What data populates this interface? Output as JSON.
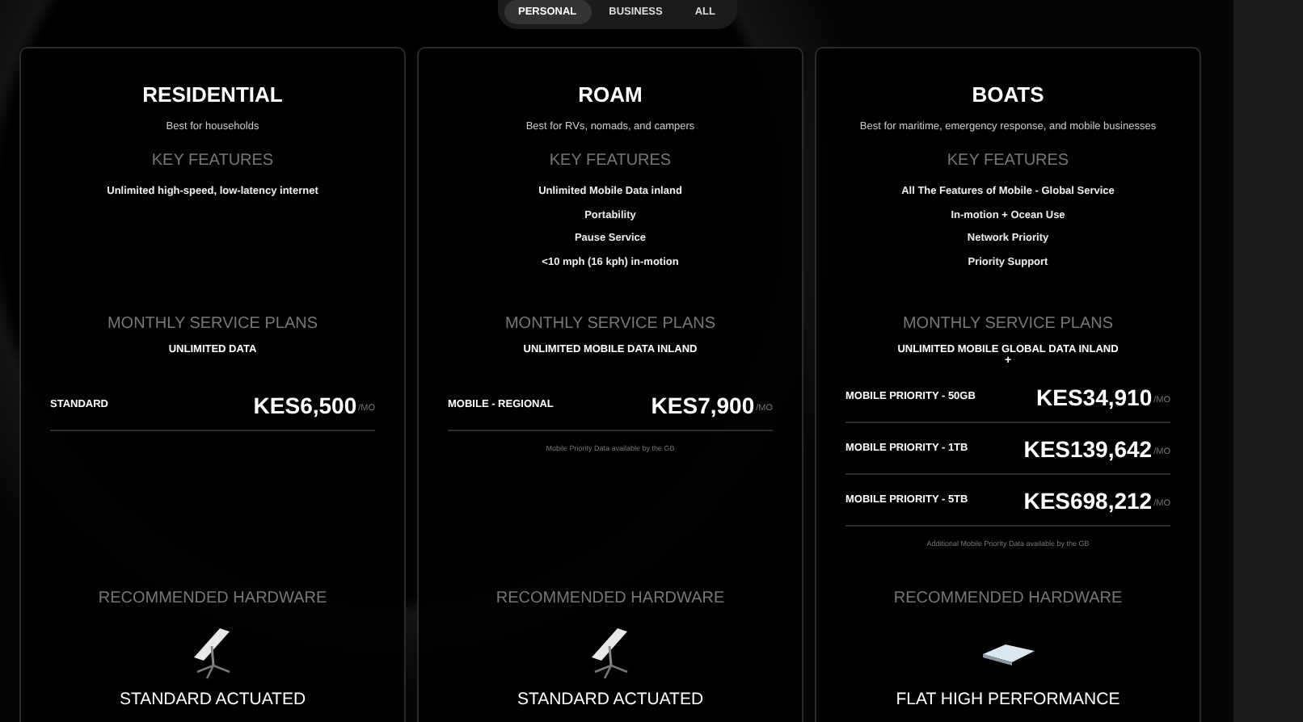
{
  "tabs": [
    {
      "label": "PERSONAL",
      "selected": true
    },
    {
      "label": "BUSINESS",
      "selected": false
    },
    {
      "label": "ALL",
      "selected": false
    }
  ],
  "cards": [
    {
      "title": "RESIDENTIAL",
      "subtitle": "Best for households",
      "features_heading": "KEY FEATURES",
      "features": [
        "Unlimited high-speed, low-latency internet"
      ],
      "plans_heading": "MONTHLY SERVICE PLANS",
      "plans_subheading": "UNLIMITED DATA",
      "plans": [
        {
          "name": "STANDARD",
          "price": "KES6,500",
          "unit": "/MO"
        }
      ],
      "hardware_heading": "RECOMMENDED HARDWARE",
      "hardware": {
        "kind": "standard",
        "name": "STANDARD ACTUATED"
      }
    },
    {
      "title": "ROAM",
      "subtitle": "Best for RVs, nomads, and campers",
      "features_heading": "KEY FEATURES",
      "features": [
        "Unlimited Mobile Data inland",
        "Portability",
        "Pause Service",
        "<10 mph (16 kph) in-motion"
      ],
      "plans_heading": "MONTHLY SERVICE PLANS",
      "plans_subheading": "UNLIMITED MOBILE DATA INLAND",
      "plans": [
        {
          "name": "MOBILE - REGIONAL",
          "price": "KES7,900",
          "unit": "/MO"
        }
      ],
      "plans_note": "Mobile Priority Data available by the GB",
      "hardware_heading": "RECOMMENDED HARDWARE",
      "hardware": {
        "kind": "standard",
        "name": "STANDARD ACTUATED"
      }
    },
    {
      "title": "BOATS",
      "subtitle": "Best for maritime, emergency response, and mobile businesses",
      "features_heading": "KEY FEATURES",
      "features": [
        "All The Features of Mobile - Global Service",
        "In-motion + Ocean Use",
        "Network Priority",
        "Priority Support"
      ],
      "plans_heading": "MONTHLY SERVICE PLANS",
      "plans_subheading": "UNLIMITED MOBILE GLOBAL DATA INLAND",
      "plans_subheading_plus": "+",
      "plans": [
        {
          "name": "MOBILE PRIORITY - 50GB",
          "price": "KES34,910",
          "unit": "/MO"
        },
        {
          "name": "MOBILE PRIORITY - 1TB",
          "price": "KES139,642",
          "unit": "/MO"
        },
        {
          "name": "MOBILE PRIORITY - 5TB",
          "price": "KES698,212",
          "unit": "/MO"
        }
      ],
      "plans_note": "Additional Mobile Priority Data available by the GB",
      "hardware_heading": "RECOMMENDED HARDWARE",
      "hardware": {
        "kind": "flat",
        "name": "FLAT HIGH PERFORMANCE"
      }
    }
  ]
}
